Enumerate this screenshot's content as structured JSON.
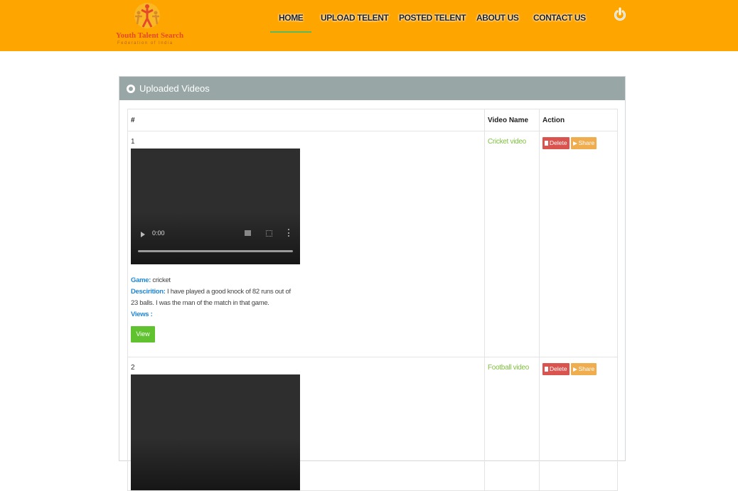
{
  "logo": {
    "title": "Youth Talent Search",
    "subtitle": "Federation of India"
  },
  "nav": {
    "items": [
      {
        "label": "HOME"
      },
      {
        "label": "UPLOAD TELENT"
      },
      {
        "label": "POSTED TELENT"
      },
      {
        "label": "ABOUT US"
      },
      {
        "label": "CONTACT US"
      }
    ],
    "power_icon": "power-icon"
  },
  "panel": {
    "title": "Uploaded Videos",
    "icon": "globe-icon"
  },
  "table": {
    "columns": [
      "#",
      "Video Name",
      "Action"
    ],
    "rows": [
      {
        "num": "1",
        "video_time": "0:00",
        "game_label": "Game:",
        "game_value": "cricket",
        "desc_label": "Descirition:",
        "desc_value": "I have played a good knock of 82 runs out of 23 balls. I was the man of the match in that game.",
        "views_label": "Views :",
        "view_button": "View",
        "video_name": "Cricket video",
        "delete_label": "Delete",
        "share_label": "Share"
      },
      {
        "num": "2",
        "video_name": "Football video",
        "delete_label": "Delete",
        "share_label": "Share"
      }
    ]
  },
  "colors": {
    "header_bg": "#ffa500",
    "panel_header_bg": "#98a6a6",
    "delete": "#d9534f",
    "share": "#f0ad4e",
    "view": "#5fc22e",
    "video_name": "#7fbf3f"
  }
}
